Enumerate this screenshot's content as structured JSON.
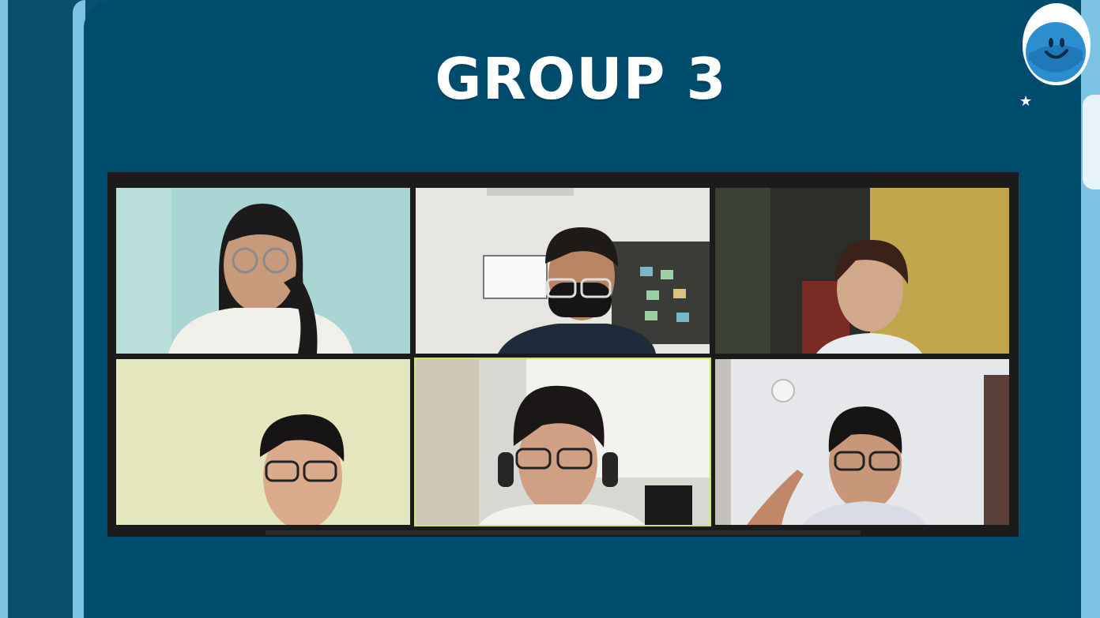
{
  "slide": {
    "title": "GROUP 3"
  },
  "decor": {
    "mascot": "smiley-mascot-icon",
    "star": "star-icon",
    "colors": {
      "background": "#004c6c",
      "frame": "#7cc3e3",
      "title": "#ffffff",
      "active_speaker_border": "#c8e86a"
    }
  },
  "video_gallery": {
    "layout": "3x2 grid",
    "active_speaker_index": 4,
    "participants": [
      {
        "name": "",
        "video": "participant-video-1"
      },
      {
        "name": "",
        "video": "participant-video-2"
      },
      {
        "name": "",
        "video": "participant-video-3"
      },
      {
        "name": "",
        "video": "participant-video-4"
      },
      {
        "name": "",
        "video": "participant-video-5"
      },
      {
        "name": "",
        "video": "participant-video-6"
      }
    ]
  }
}
